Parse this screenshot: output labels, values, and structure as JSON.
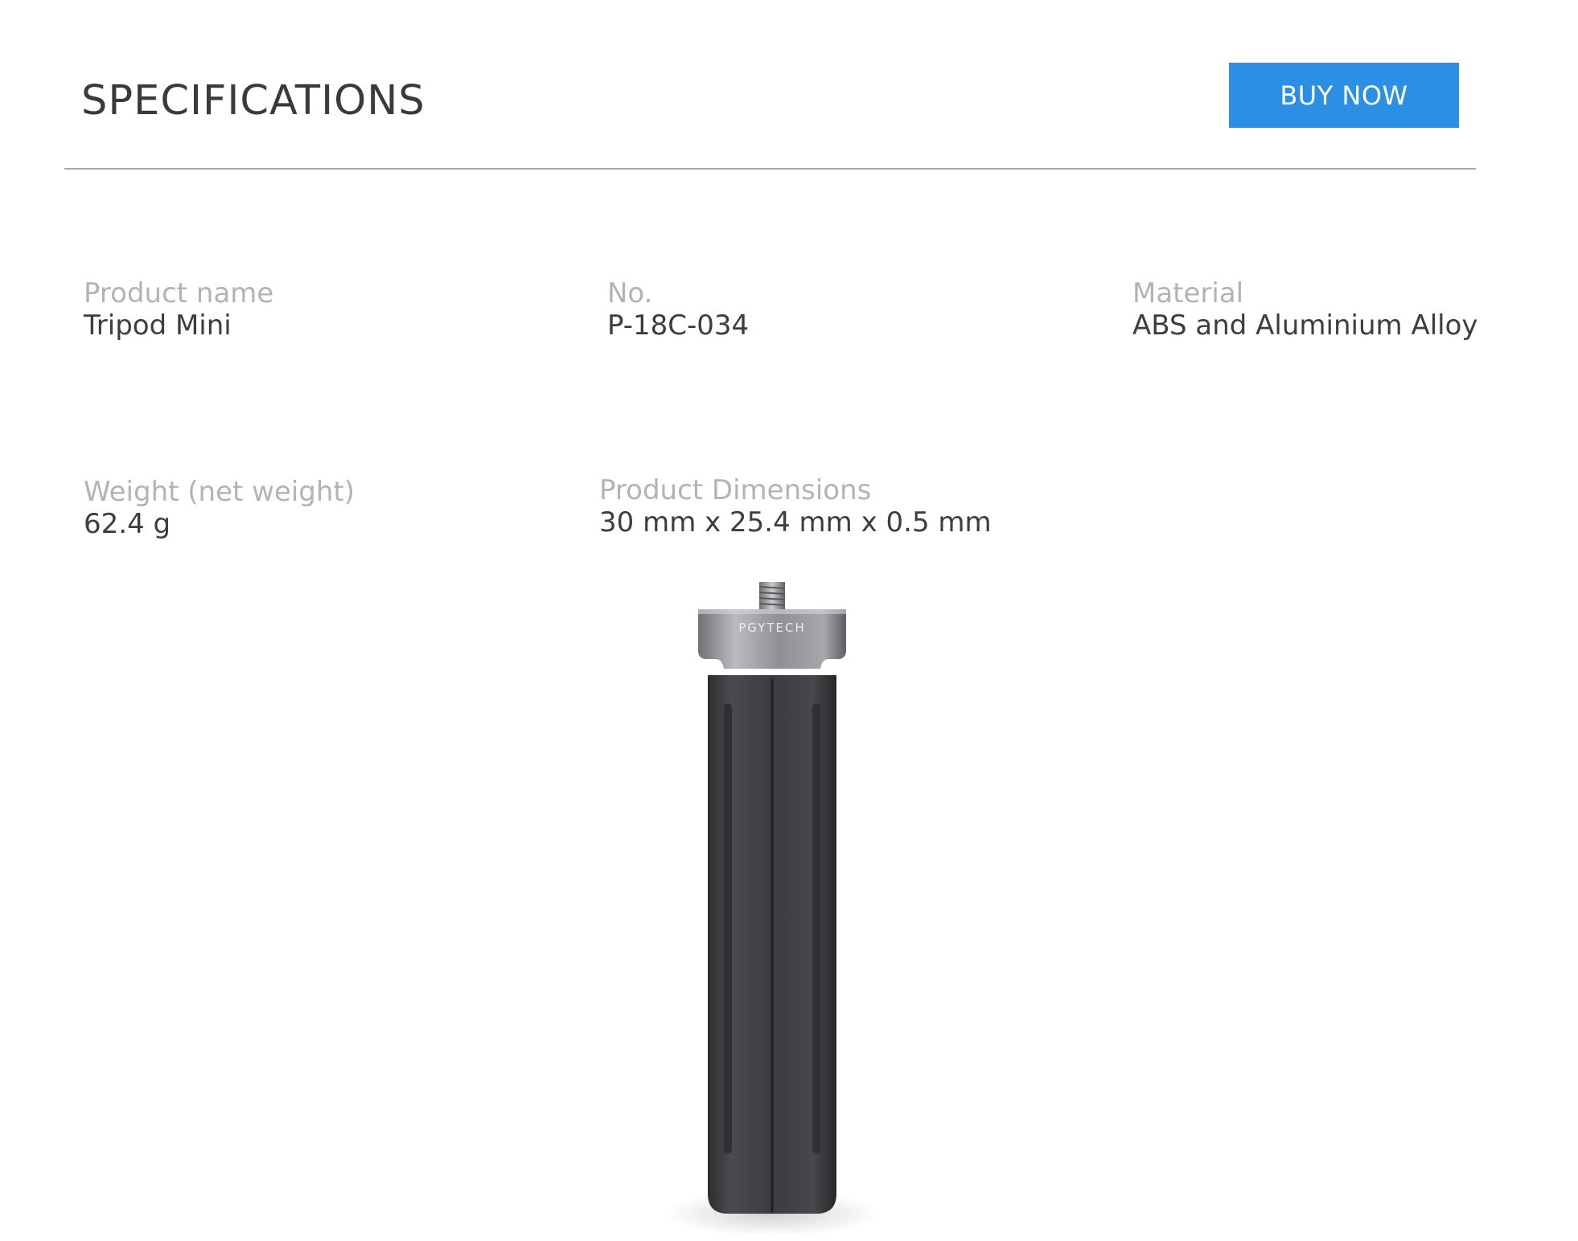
{
  "header": {
    "title": "SPECIFICATIONS",
    "buy_label": "BUY NOW",
    "buy_color": "#2b8fe3"
  },
  "specs": [
    {
      "label": "Product name",
      "value": "Tripod Mini"
    },
    {
      "label": "No.",
      "value": "P-18C-034"
    },
    {
      "label": "Material",
      "value": "ABS and Aluminium Alloy"
    },
    {
      "label": "Weight (net weight)",
      "value": "62.4 g"
    },
    {
      "label": "Product Dimensions",
      "value": "30 mm x 25.4 mm x 0.5 mm"
    }
  ],
  "product_image": {
    "brand_mark": "PGYTECH",
    "icon": "tripod-mini-product-photo"
  }
}
